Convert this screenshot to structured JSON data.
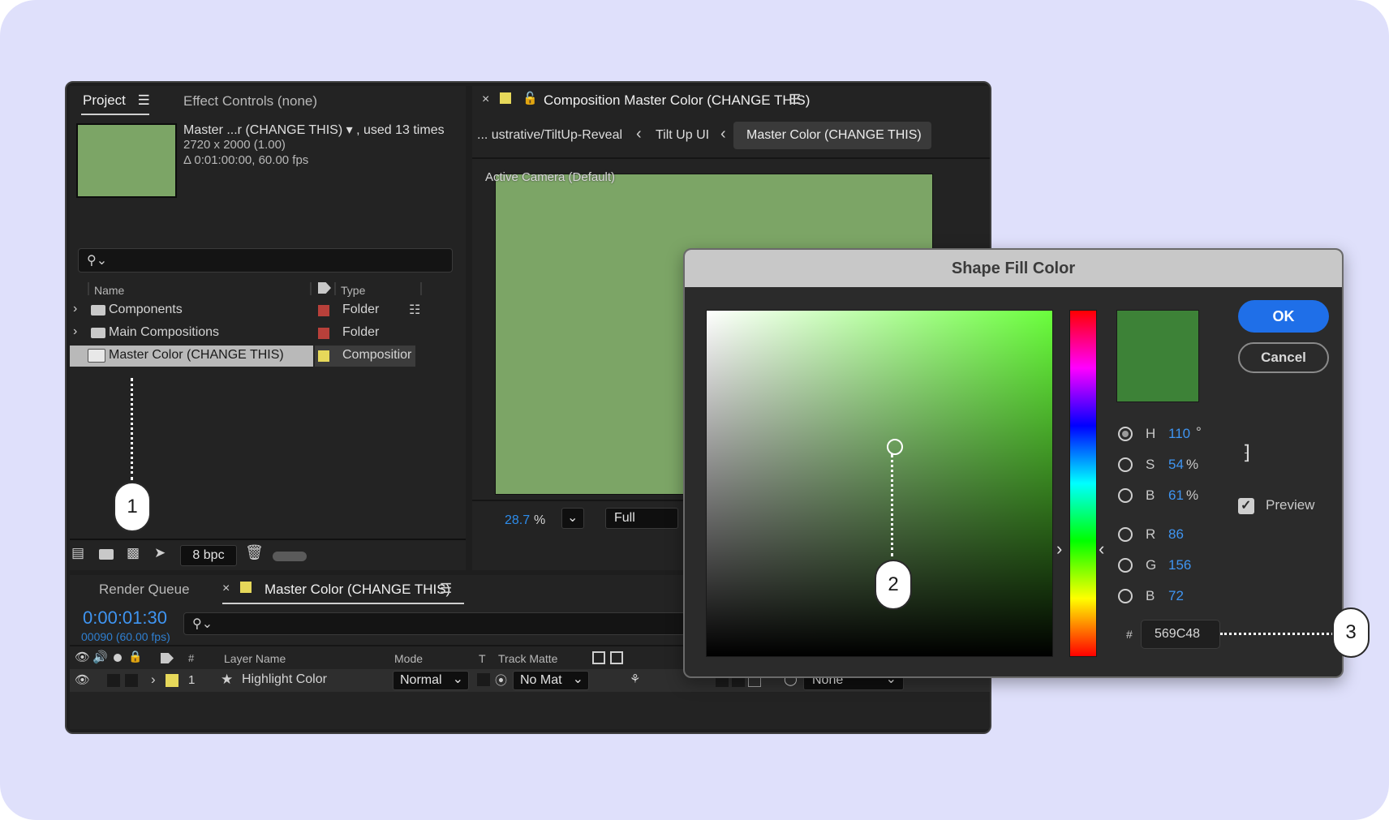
{
  "project_panel": {
    "tab_project": "Project",
    "tab_effect_controls": "Effect Controls (none)",
    "item_name": "Master ...r (CHANGE THIS) ▾ , used 13 times",
    "item_dimensions": "2720 x 2000 (1.00)",
    "item_duration": "Δ 0:01:00:00, 60.00 fps",
    "thumb_color": "#7ca566",
    "search_placeholder": "",
    "col_name": "Name",
    "col_type": "Type",
    "rows": [
      {
        "name": "Components",
        "type": "Folder",
        "label_color": "#b8403a"
      },
      {
        "name": "Main Compositions",
        "type": "Folder",
        "label_color": "#b8403a"
      },
      {
        "name": "Master Color (CHANGE THIS)",
        "type": "Compositior",
        "label_color": "#e6d85a"
      }
    ],
    "bpc": "8 bpc"
  },
  "composition_panel": {
    "title": "Composition Master Color (CHANGE THIS)",
    "breadcrumb_1": "... ustrative/TiltUp-Reveal",
    "breadcrumb_2": "Tilt Up UI",
    "breadcrumb_3": "Master Color (CHANGE THIS)",
    "viewer_label": "Active Camera (Default)",
    "viewer_color": "#7ca566",
    "zoom_value": "28.7",
    "zoom_unit": "%",
    "resolution": "Full"
  },
  "timeline_panel": {
    "tab_render_queue": "Render Queue",
    "tab_comp": "Master Color (CHANGE THIS)",
    "timecode": "0:00:01:30",
    "frames": "00090 (60.00 fps)",
    "col_hash": "#",
    "col_layer_name": "Layer Name",
    "col_mode": "Mode",
    "col_t": "T",
    "col_track_matte": "Track Matte",
    "layer_number": "1",
    "layer_name": "Highlight Color",
    "layer_mode": "Normal",
    "layer_matte": "No Mat",
    "layer_parent": "None"
  },
  "color_dialog": {
    "title": "Shape Fill Color",
    "ok_label": "OK",
    "cancel_label": "Cancel",
    "preview_label": "Preview",
    "preview_checked": true,
    "current_color": "#3d8237",
    "hue_color": "#6aff3c",
    "h_label": "H",
    "h_value": "110",
    "h_unit": "°",
    "s_label": "S",
    "s_value": "54",
    "s_unit": "%",
    "b_label": "B",
    "b_value": "61",
    "b_unit": "%",
    "r_label": "R",
    "r_value": "86",
    "g_label": "G",
    "g_value": "156",
    "bb_label": "B",
    "bb_value": "72",
    "hex_symbol": "#",
    "hex_value": "569C48"
  },
  "callouts": {
    "one": "1",
    "two": "2",
    "three": "3"
  },
  "colors": {
    "background": "#dfe0fb",
    "accent_blue": "#1f6fe8"
  }
}
